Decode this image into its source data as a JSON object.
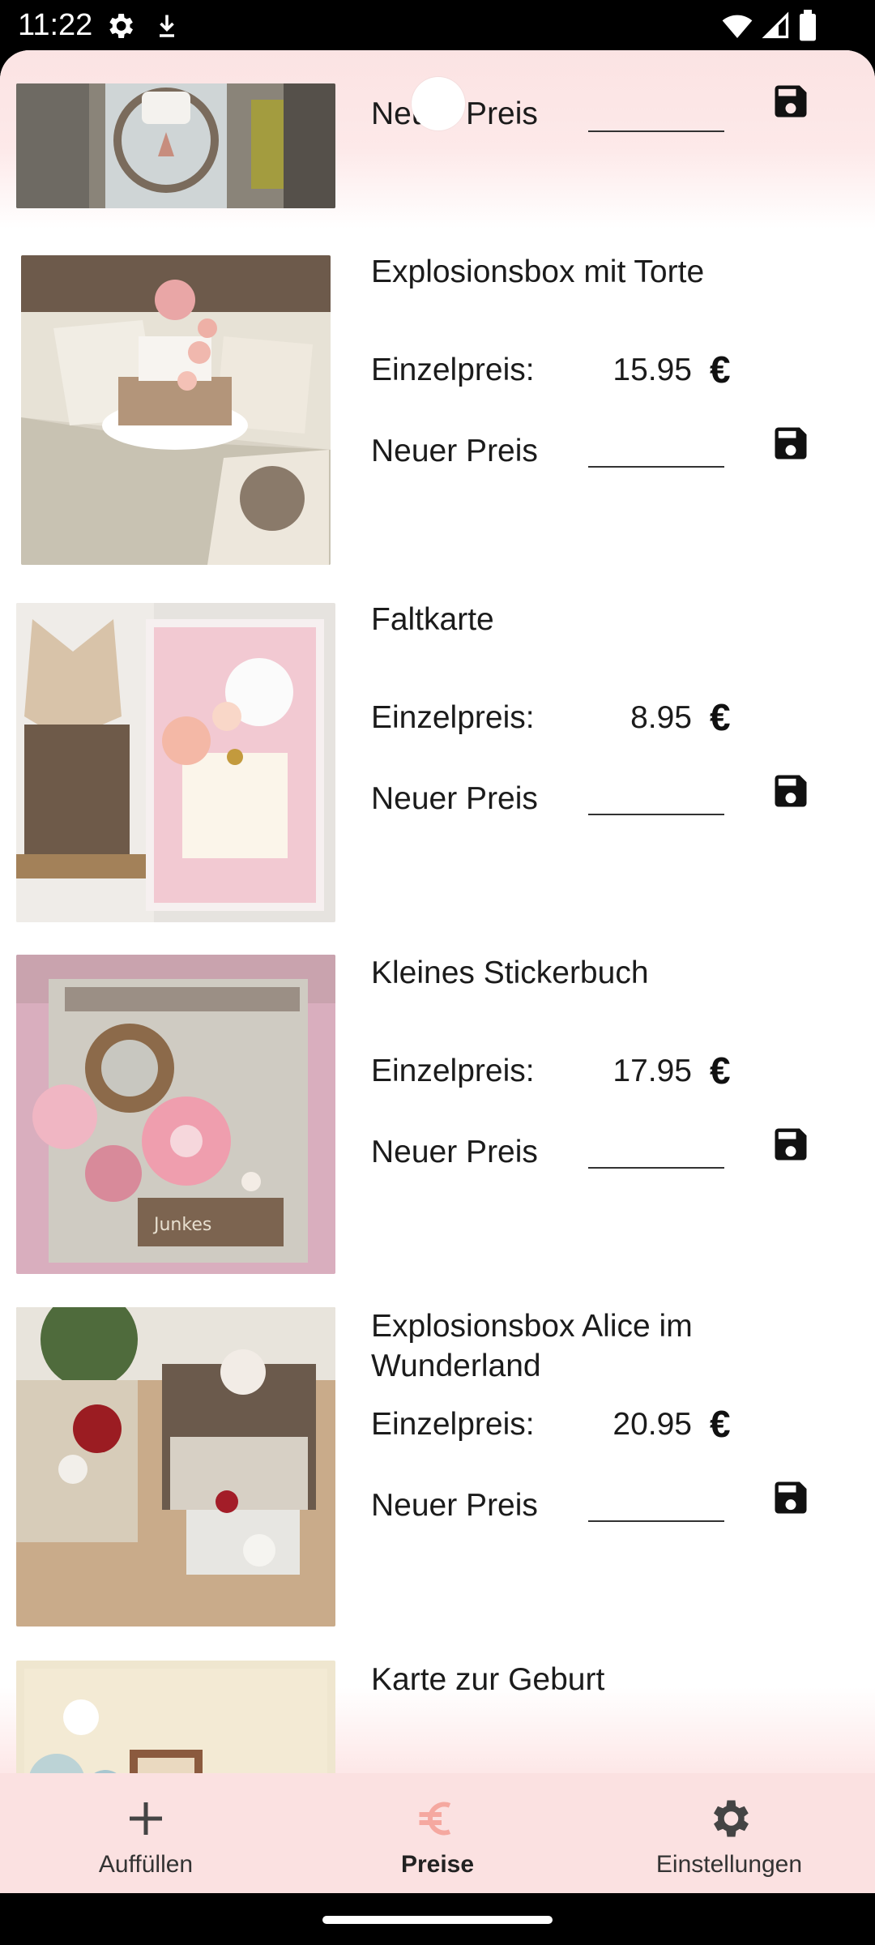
{
  "status_bar": {
    "time": "11:22"
  },
  "labels": {
    "einzelpreis": "Einzelpreis:",
    "neuer_preis": "Neuer Preis",
    "currency": "€"
  },
  "products": [
    {
      "name": "",
      "price": ""
    },
    {
      "name": "Explosionsbox mit Torte",
      "price": "15.95"
    },
    {
      "name": "Faltkarte",
      "price": "8.95"
    },
    {
      "name": "Kleines Stickerbuch",
      "price": "17.95"
    },
    {
      "name": "Explosionsbox Alice im Wunderland",
      "price": "20.95"
    },
    {
      "name": "Karte zur Geburt",
      "price": ""
    }
  ],
  "bottom_nav": {
    "items": [
      {
        "label": "Auffüllen",
        "icon": "plus-icon",
        "active": false
      },
      {
        "label": "Preise",
        "icon": "euro-icon",
        "active": true
      },
      {
        "label": "Einstellungen",
        "icon": "gear-icon",
        "active": false
      }
    ]
  },
  "colors": {
    "accent_pink": "#fbe1e1",
    "active_icon": "#f5a8a0"
  }
}
